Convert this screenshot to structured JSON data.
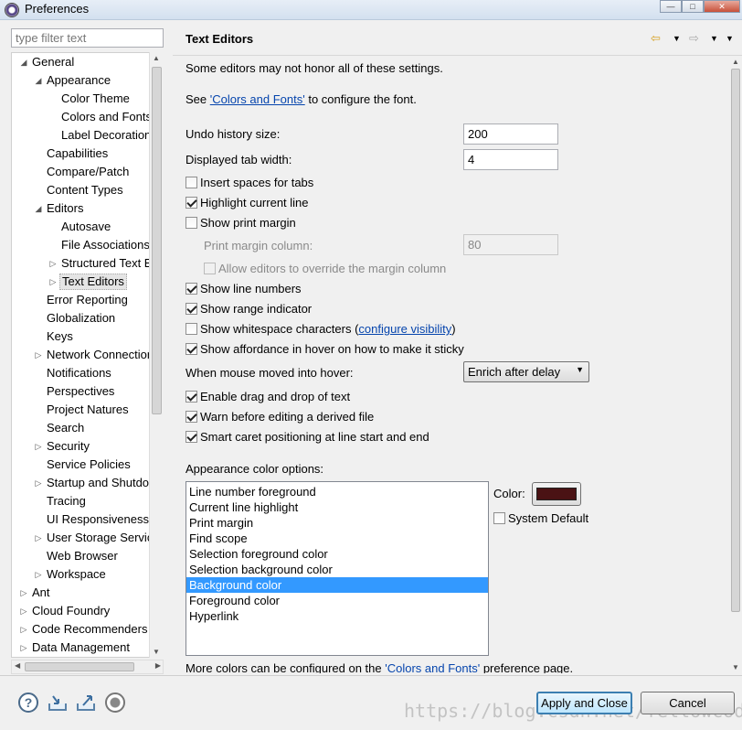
{
  "window": {
    "title": "Preferences",
    "buttons": [
      "—",
      "□",
      "✕"
    ]
  },
  "filter": {
    "placeholder": "type filter text"
  },
  "tree": [
    {
      "label": "General",
      "indent": 0,
      "arrow": "◢"
    },
    {
      "label": "Appearance",
      "indent": 1,
      "arrow": "◢"
    },
    {
      "label": "Color Theme",
      "indent": 2,
      "arrow": ""
    },
    {
      "label": "Colors and Fonts",
      "indent": 2,
      "arrow": ""
    },
    {
      "label": "Label Decorations",
      "indent": 2,
      "arrow": ""
    },
    {
      "label": "Capabilities",
      "indent": 1,
      "arrow": ""
    },
    {
      "label": "Compare/Patch",
      "indent": 1,
      "arrow": ""
    },
    {
      "label": "Content Types",
      "indent": 1,
      "arrow": ""
    },
    {
      "label": "Editors",
      "indent": 1,
      "arrow": "◢"
    },
    {
      "label": "Autosave",
      "indent": 2,
      "arrow": ""
    },
    {
      "label": "File Associations",
      "indent": 2,
      "arrow": ""
    },
    {
      "label": "Structured Text Editors",
      "indent": 2,
      "arrow": "▷"
    },
    {
      "label": "Text Editors",
      "indent": 2,
      "arrow": "▷",
      "selected": true
    },
    {
      "label": "Error Reporting",
      "indent": 1,
      "arrow": ""
    },
    {
      "label": "Globalization",
      "indent": 1,
      "arrow": ""
    },
    {
      "label": "Keys",
      "indent": 1,
      "arrow": ""
    },
    {
      "label": "Network Connections",
      "indent": 1,
      "arrow": "▷"
    },
    {
      "label": "Notifications",
      "indent": 1,
      "arrow": ""
    },
    {
      "label": "Perspectives",
      "indent": 1,
      "arrow": ""
    },
    {
      "label": "Project Natures",
      "indent": 1,
      "arrow": ""
    },
    {
      "label": "Search",
      "indent": 1,
      "arrow": ""
    },
    {
      "label": "Security",
      "indent": 1,
      "arrow": "▷"
    },
    {
      "label": "Service Policies",
      "indent": 1,
      "arrow": ""
    },
    {
      "label": "Startup and Shutdown",
      "indent": 1,
      "arrow": "▷"
    },
    {
      "label": "Tracing",
      "indent": 1,
      "arrow": ""
    },
    {
      "label": "UI Responsiveness",
      "indent": 1,
      "arrow": ""
    },
    {
      "label": "User Storage Service",
      "indent": 1,
      "arrow": "▷"
    },
    {
      "label": "Web Browser",
      "indent": 1,
      "arrow": ""
    },
    {
      "label": "Workspace",
      "indent": 1,
      "arrow": "▷"
    },
    {
      "label": "Ant",
      "indent": 0,
      "arrow": "▷"
    },
    {
      "label": "Cloud Foundry",
      "indent": 0,
      "arrow": "▷"
    },
    {
      "label": "Code Recommenders",
      "indent": 0,
      "arrow": "▷"
    },
    {
      "label": "Data Management",
      "indent": 0,
      "arrow": "▷"
    }
  ],
  "page": {
    "title": "Text Editors",
    "intro": "Some editors may not honor all of these settings.",
    "see_prefix": "See ",
    "see_link": "'Colors and Fonts'",
    "see_suffix": " to configure the font.",
    "undo_label": "Undo history size:",
    "undo_value": "200",
    "tab_label": "Displayed tab width:",
    "tab_value": "4",
    "insert_spaces": "Insert spaces for tabs",
    "highlight_line": "Highlight current line",
    "show_print_margin": "Show print margin",
    "print_margin_col_label": "Print margin column:",
    "print_margin_col_value": "80",
    "allow_override": "Allow editors to override the margin column",
    "show_line_numbers": "Show line numbers",
    "show_range": "Show range indicator",
    "show_whitespace": "Show whitespace characters (",
    "configure_visibility": "configure visibility",
    "show_whitespace_end": ")",
    "show_affordance": "Show affordance in hover on how to make it sticky",
    "hover_label": "When mouse moved into hover:",
    "hover_value": "Enrich after delay",
    "drag_drop": "Enable drag and drop of text",
    "warn_derived": "Warn before editing a derived file",
    "smart_caret": "Smart caret positioning at line start and end",
    "appearance_label": "Appearance color options:",
    "color_options": [
      "Line number foreground",
      "Current line highlight",
      "Print margin",
      "Find scope",
      "Selection foreground color",
      "Selection background color",
      "Background color",
      "Foreground color",
      "Hyperlink"
    ],
    "selected_color_option": "Background color",
    "color_label": "Color:",
    "swatch_color": "#4a1214",
    "system_default": "System Default",
    "more_colors_prefix": "More colors can be configured on the ",
    "more_colors_link": "'Colors and Fonts'",
    "more_colors_suffix": " preference page."
  },
  "buttons": {
    "apply_close": "Apply and Close",
    "cancel": "Cancel"
  },
  "watermark": "https://blog.csdn.net/fellowcode_jin"
}
